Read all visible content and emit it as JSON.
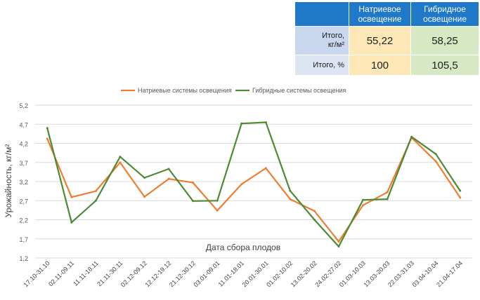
{
  "table": {
    "columns": [
      "Натриевое освещение",
      "Гибридное освещение"
    ],
    "rows": [
      {
        "label_line1": "Итого,",
        "label_line2": "кг/м²",
        "values": [
          "55,22",
          "58,25"
        ]
      },
      {
        "label_line1": "Итого, %",
        "label_line2": "",
        "values": [
          "100",
          "105,5"
        ]
      }
    ]
  },
  "chart_data": {
    "type": "line",
    "categories": [
      "17.10-31.10",
      "02.11-09.11",
      "11.11-18.11",
      "21.11-30.11",
      "02.12-09.12",
      "12.12-19.12",
      "21.12-30.12",
      "03.01-09.01",
      "11.01-18.01",
      "20.01-30.01",
      "01.02-10.02",
      "13.02-20.02",
      "24.02-27.02",
      "01.03-10.03",
      "13.03-20.03",
      "22.03-31.03",
      "03.04-10.04",
      "21.04-17.04"
    ],
    "series": [
      {
        "name": "Натриевые системы освещения",
        "color": "#ed7d31",
        "values": [
          4.32,
          2.79,
          2.95,
          3.7,
          2.8,
          3.27,
          3.17,
          2.44,
          3.13,
          3.55,
          2.74,
          2.43,
          1.63,
          2.58,
          2.92,
          4.35,
          3.73,
          2.78
        ]
      },
      {
        "name": "Гибридные системы освещения",
        "color": "#4e8a34",
        "values": [
          4.6,
          2.13,
          2.7,
          3.85,
          3.3,
          3.53,
          2.69,
          2.7,
          4.72,
          4.75,
          2.96,
          2.2,
          1.5,
          2.72,
          2.74,
          4.37,
          3.92,
          2.96
        ]
      }
    ],
    "xlabel": "Дата сбора плодов",
    "ylabel": "Урожайность, кг/м²",
    "yticks": [
      "5,2",
      "4,7",
      "4,2",
      "3,7",
      "3,2",
      "2,7",
      "2,2",
      "1,7",
      "1,2"
    ],
    "ylim": [
      1.2,
      5.2
    ],
    "grid": true,
    "legend_position": "top"
  }
}
